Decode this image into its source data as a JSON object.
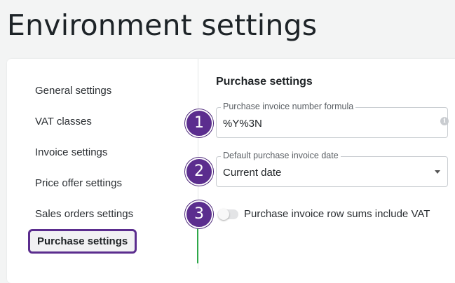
{
  "page": {
    "title": "Environment settings"
  },
  "sidebar": {
    "items": [
      {
        "label": "General settings"
      },
      {
        "label": "VAT classes"
      },
      {
        "label": "Invoice settings"
      },
      {
        "label": "Price offer settings"
      },
      {
        "label": "Sales orders settings"
      },
      {
        "label": "Purchase settings",
        "active": true
      }
    ]
  },
  "purchase": {
    "section_title": "Purchase settings",
    "formula": {
      "label": "Purchase invoice number formula",
      "value": "%Y%3N",
      "info_icon": "info-icon"
    },
    "default_date": {
      "label": "Default purchase invoice date",
      "value": "Current date"
    },
    "row_sums_vat": {
      "label": "Purchase invoice row sums include VAT",
      "enabled": false
    }
  },
  "steps": [
    "1",
    "2",
    "3"
  ],
  "colors": {
    "accent": "#5b2d8e",
    "active_indicator": "#2ea84a"
  }
}
